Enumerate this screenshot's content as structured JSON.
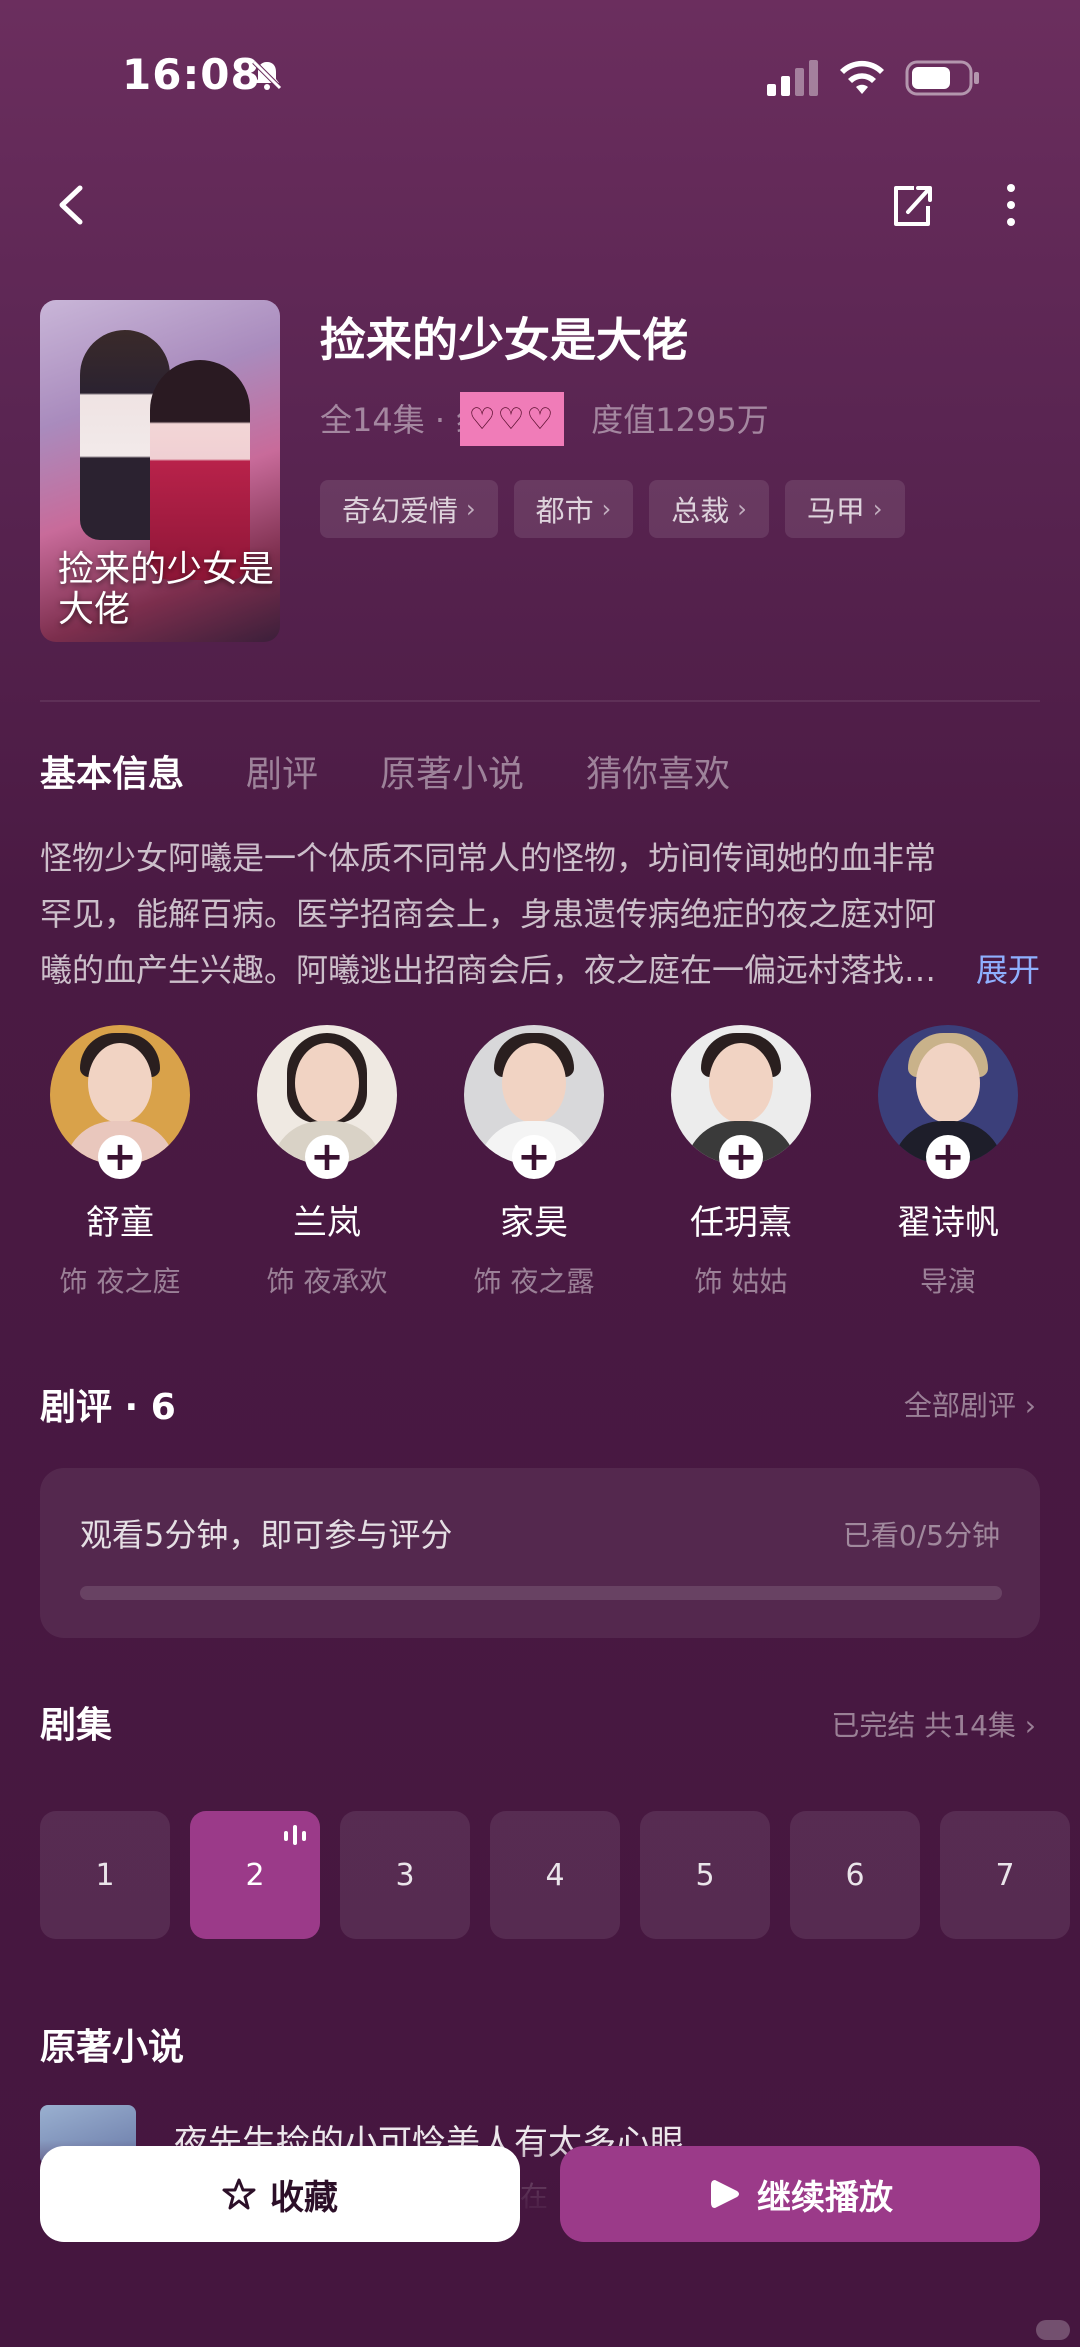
{
  "status_bar": {
    "time": "16:08"
  },
  "drama": {
    "title": "捡来的少女是大佬",
    "poster_title": "捡来的少女是大佬",
    "meta_left": "全14集 · 纟",
    "sticker": "♡♡♡",
    "meta_right": "度值1295万",
    "tags": [
      "奇幻爱情",
      "都市",
      "总裁",
      "马甲"
    ]
  },
  "tabs": [
    "基本信息",
    "剧评",
    "原著小说",
    "猜你喜欢"
  ],
  "synopsis": {
    "text": "怪物少女阿曦是一个体质不同常人的怪物，坊间传闻她的血非常罕见，能解百病。医学招商会上，身患遗传病绝症的夜之庭对阿曦的血产生兴趣。阿曦逃出招商会后，夜之庭在一偏远村落找…",
    "expand": "展开"
  },
  "cast": [
    {
      "name": "舒童",
      "role": "饰 夜之庭",
      "bg": "#d9a24a"
    },
    {
      "name": "兰岚",
      "role": "饰 夜承欢",
      "bg": "#efe9e2"
    },
    {
      "name": "家昊",
      "role": "饰 夜之露",
      "bg": "#d8d8da"
    },
    {
      "name": "任玥熹",
      "role": "饰 姑姑",
      "bg": "#ececec"
    },
    {
      "name": "翟诗帆",
      "role": "导演",
      "bg": "#3b3f7a"
    }
  ],
  "reviews": {
    "title": "剧评 · 6",
    "link": "全部剧评 ›",
    "prompt": "观看5分钟，即可参与评分",
    "progress_text": "已看0/5分钟",
    "progress": 0
  },
  "episodes": {
    "title": "剧集",
    "link": "已完结 共14集 ›",
    "items": [
      "1",
      "2",
      "3",
      "4",
      "5",
      "6",
      "7"
    ],
    "current": "2"
  },
  "novel": {
    "title": "原著小说",
    "book_title": "夜先生捡的小可怜美人有太多心眼",
    "book_sub": "在"
  },
  "actions": {
    "favorite": "收藏",
    "continue": "继续播放"
  }
}
